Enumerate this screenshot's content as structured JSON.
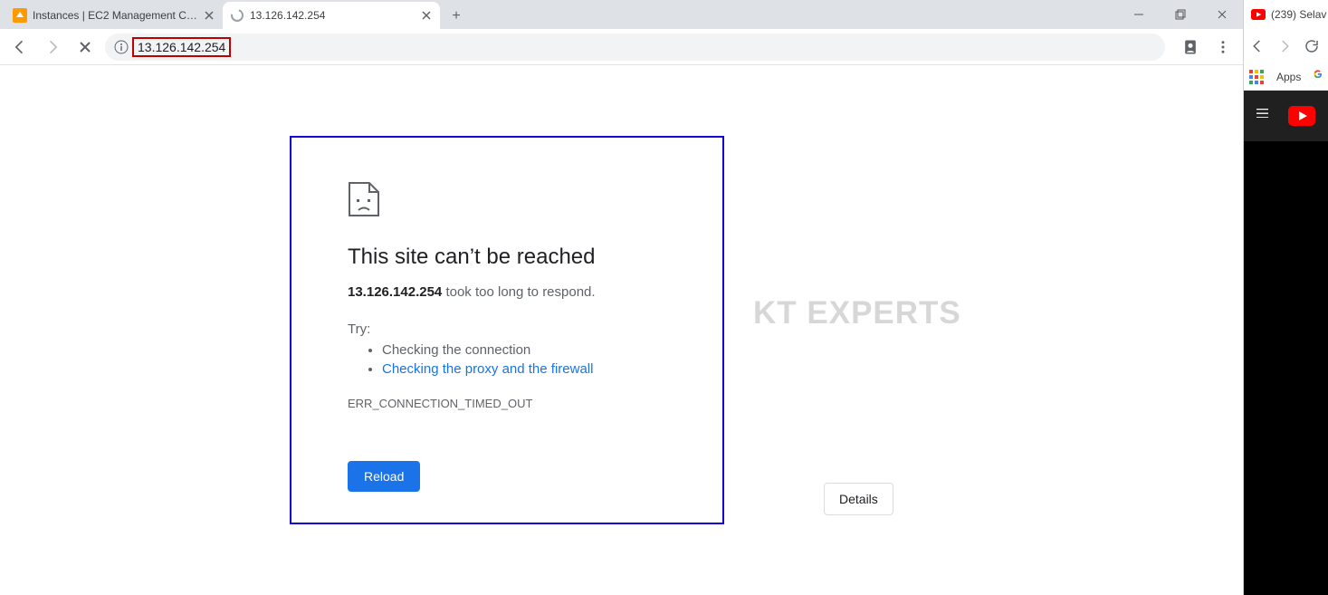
{
  "tabs": [
    {
      "title": "Instances | EC2 Management Con",
      "active": false
    },
    {
      "title": "13.126.142.254",
      "active": true
    }
  ],
  "address_bar": {
    "url": "13.126.142.254"
  },
  "error_page": {
    "heading": "This site can’t be reached",
    "host": "13.126.142.254",
    "host_suffix": " took too long to respond.",
    "try_label": "Try:",
    "suggestions": {
      "check_connection": "Checking the connection",
      "check_proxy": "Checking the proxy and the firewall"
    },
    "error_code": "ERR_CONNECTION_TIMED_OUT",
    "reload_label": "Reload",
    "details_label": "Details"
  },
  "watermark": "KT EXPERTS",
  "right_window": {
    "tab_title": "(239) Selav",
    "apps_label": "Apps"
  }
}
